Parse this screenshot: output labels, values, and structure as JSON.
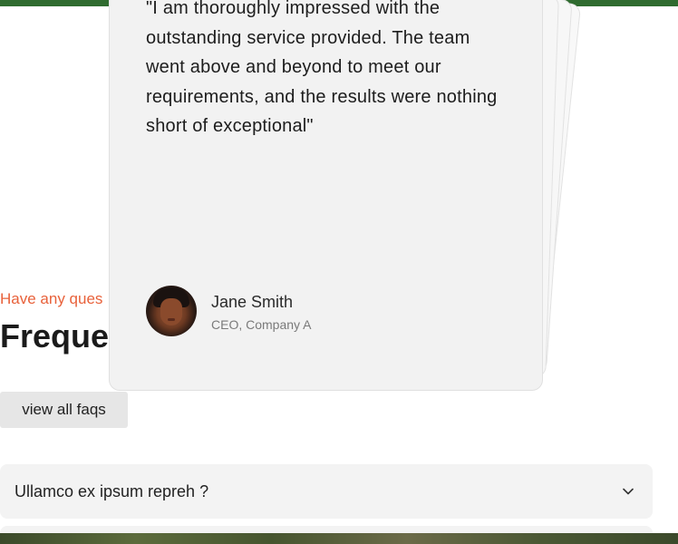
{
  "testimonial": {
    "quote": "\"I am thoroughly impressed with the outstanding service provided. The team went above and beyond to meet our requirements, and the results were nothing short of exceptional\"",
    "author_name": "Jane Smith",
    "author_role": "CEO, Company A"
  },
  "faq": {
    "eyebrow": "Have any ques",
    "heading": "Freque",
    "view_all_label": "view all faqs",
    "items": [
      {
        "question": "Ullamco ex ipsum repreh ?"
      }
    ]
  },
  "colors": {
    "accent": "#e8613a",
    "top_bar": "#2f6b2f"
  }
}
